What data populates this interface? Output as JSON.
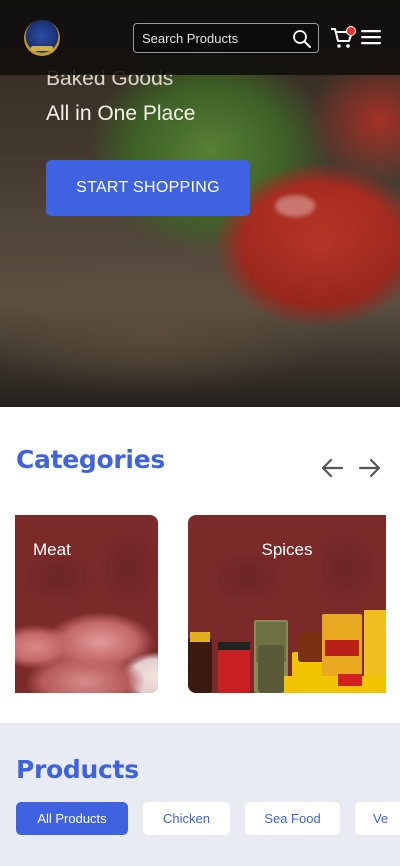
{
  "header": {
    "logo": "brand-logo",
    "search_placeholder": "Search Products",
    "cart_badge_color": "#e8312a",
    "icons": [
      "search-icon",
      "cart-icon",
      "hamburger-menu-icon"
    ]
  },
  "hero": {
    "line1": "Baked Goods",
    "line2": "All in One Place",
    "cta_label": "START SHOPPING"
  },
  "categories": {
    "title": "Categories",
    "items": [
      {
        "label": "Meat"
      },
      {
        "label": "Spices"
      }
    ]
  },
  "products": {
    "title": "Products",
    "filters": [
      {
        "label": "All Products",
        "active": true
      },
      {
        "label": "Chicken",
        "active": false
      },
      {
        "label": "Sea Food",
        "active": false
      },
      {
        "label": "Ve",
        "active": false
      }
    ]
  },
  "colors": {
    "accent": "#3f63e0",
    "category_card": "#7b2a2a",
    "products_bg": "#e9ebf2"
  }
}
